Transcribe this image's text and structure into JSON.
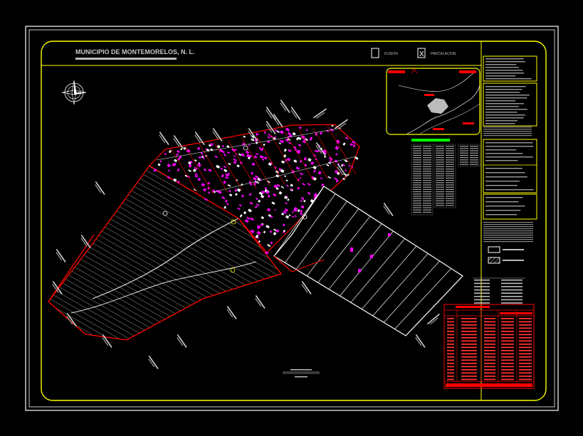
{
  "title": "MUNICIPIO DE MONTEMORELOS, N. L.",
  "options": [
    {
      "label": "FUSION",
      "checked": false
    },
    {
      "label": "PARCELACION",
      "checked": true,
      "mark": "X"
    }
  ],
  "colors": {
    "background": "#000000",
    "frame": "#ffffff",
    "border": "#ffff00",
    "boundary": "#ff0000",
    "lots": "#ff00ff",
    "text": "#ffffff",
    "table_red": "#ff0000",
    "accent_green": "#00ff00"
  },
  "icons": [
    "north-arrow-icon",
    "location-map",
    "fusion-checkbox",
    "parcelacion-checkbox",
    "legend-swatch-solid",
    "legend-swatch-hatched"
  ]
}
